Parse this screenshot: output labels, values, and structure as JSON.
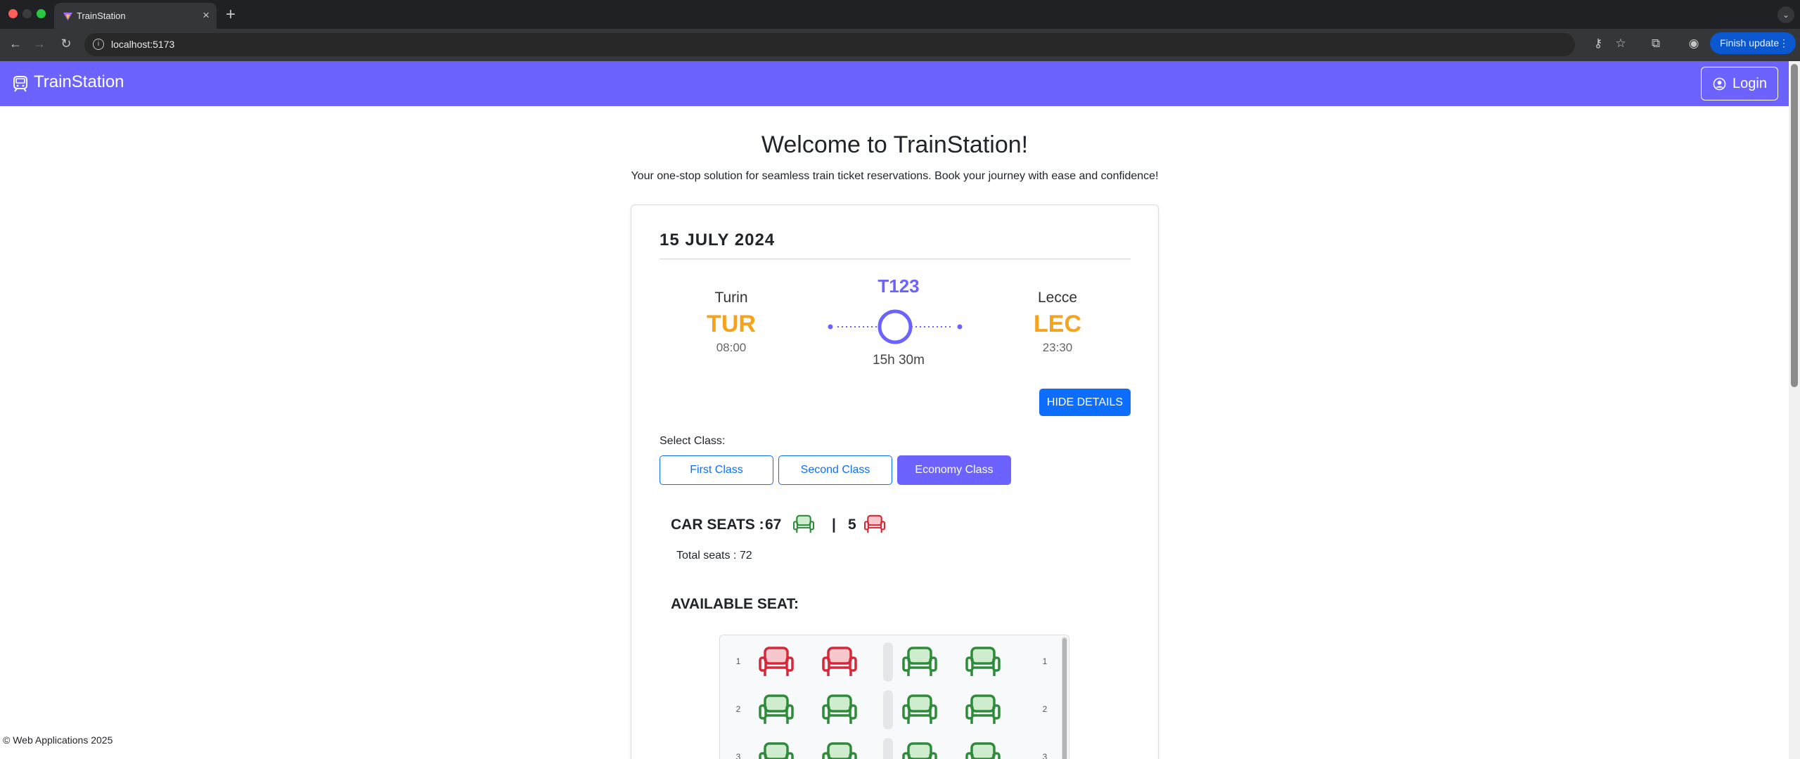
{
  "browser": {
    "tab_title": "TrainStation",
    "url": "localhost:5173",
    "update_label": "Finish update"
  },
  "app": {
    "brand": "TrainStation",
    "login_label": "Login",
    "colors": {
      "accent": "#6c63ff",
      "station_code": "#f7a21b",
      "primary": "#0d6efd",
      "seat_free": "#2e8b3a",
      "seat_taken": "#d62839"
    }
  },
  "hero": {
    "title": "Welcome to TrainStation!",
    "subtitle": "Your one-stop solution for seamless train ticket reservations. Book your journey with ease and confidence!"
  },
  "trip": {
    "date": "15 JULY 2024",
    "train": "T123",
    "duration": "15h 30m",
    "from": {
      "city": "Turin",
      "code": "TUR",
      "time": "08:00"
    },
    "to": {
      "city": "Lecce",
      "code": "LEC",
      "time": "23:30"
    },
    "details_button": "HIDE DETAILS"
  },
  "classes": {
    "label": "Select Class:",
    "options": [
      "First Class",
      "Second Class",
      "Economy Class"
    ],
    "selected": "Economy Class"
  },
  "seats": {
    "car_label": "CAR SEATS :",
    "available_count": "67",
    "separator": "|",
    "occupied_count": "5",
    "total_text": "Total seats : 72",
    "available_label": "AVAILABLE SEAT:",
    "rows": [
      {
        "num": "1",
        "seats": [
          "taken",
          "taken",
          "free",
          "free"
        ]
      },
      {
        "num": "2",
        "seats": [
          "free",
          "free",
          "free",
          "free"
        ]
      },
      {
        "num": "3",
        "seats": [
          "free",
          "free",
          "free",
          "free"
        ]
      }
    ]
  },
  "footer": "© Web Applications 2025"
}
